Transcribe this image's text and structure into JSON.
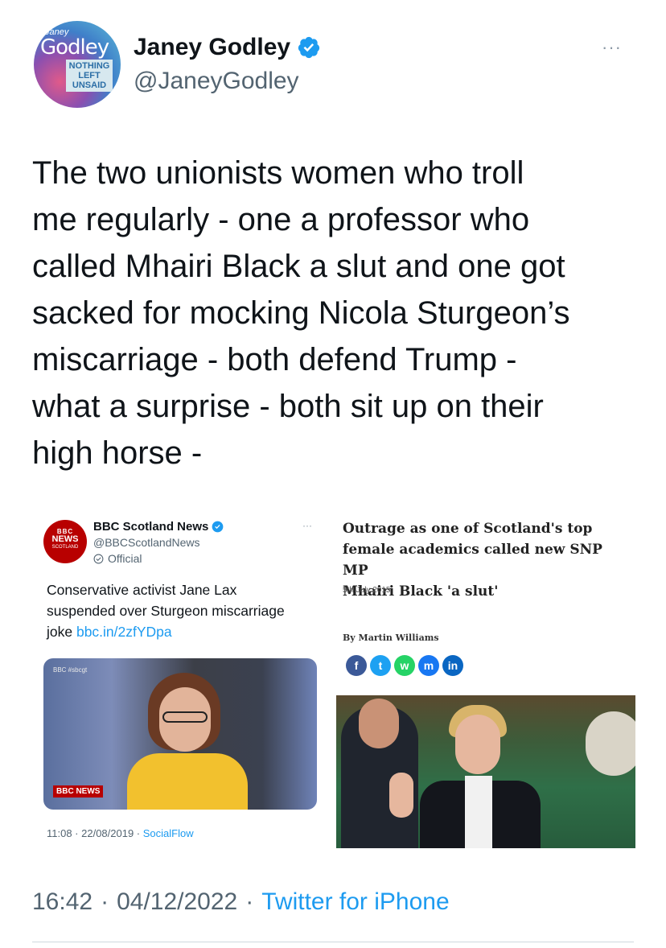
{
  "author": {
    "avatar_small": "Janey",
    "avatar_big": "Godley",
    "avatar_box": [
      "NOTHING",
      "LEFT",
      "UNSAID"
    ],
    "name": "Janey Godley",
    "handle": "@JaneyGodley",
    "more": "···"
  },
  "tweet": {
    "lines": [
      "The two unionists women who troll",
      "me regularly - one a professor who",
      "called Mhairi Black a slut and one got",
      "sacked for mocking Nicola Sturgeon’s",
      "miscarriage - both defend Trump -",
      "what a surprise - both sit up on their",
      "high horse -"
    ]
  },
  "embed_left": {
    "logo_l1": "BBC",
    "logo_l2": "NEWS",
    "logo_l3": "SCOTLAND",
    "name": "BBC Scotland News",
    "handle": "@BBCScotlandNews",
    "official": "Official",
    "more": "···",
    "text_lines": [
      "Conservative activist Jane Lax",
      "suspended over Sturgeon miscarriage",
      "joke "
    ],
    "link": "bbc.in/2zfYDpa",
    "photo_top": "BBC #sbcgt",
    "photo_tag": "BBC NEWS",
    "time": "11:08 · 22/08/2019 · ",
    "source": "SocialFlow"
  },
  "embed_right": {
    "headline_lines": [
      "Outrage as one of Scotland's top",
      "female academics called new SNP MP",
      "Mhairi Black 'a slut'"
    ],
    "date": "5th July 2015",
    "byline": "By Martin Williams",
    "share": [
      {
        "label": "f",
        "color": "#3b5998"
      },
      {
        "label": "t",
        "color": "#1da1f2"
      },
      {
        "label": "w",
        "color": "#25d366"
      },
      {
        "label": "m",
        "color": "#1877f2"
      },
      {
        "label": "in",
        "color": "#0a66c2"
      }
    ]
  },
  "footer": {
    "time": "16:42",
    "sep1": "·",
    "date": "04/12/2022",
    "sep2": "·",
    "client": "Twitter for iPhone"
  },
  "colors": {
    "accent": "#1d9bf0",
    "secondary": "#536471",
    "text": "#0f1419"
  }
}
